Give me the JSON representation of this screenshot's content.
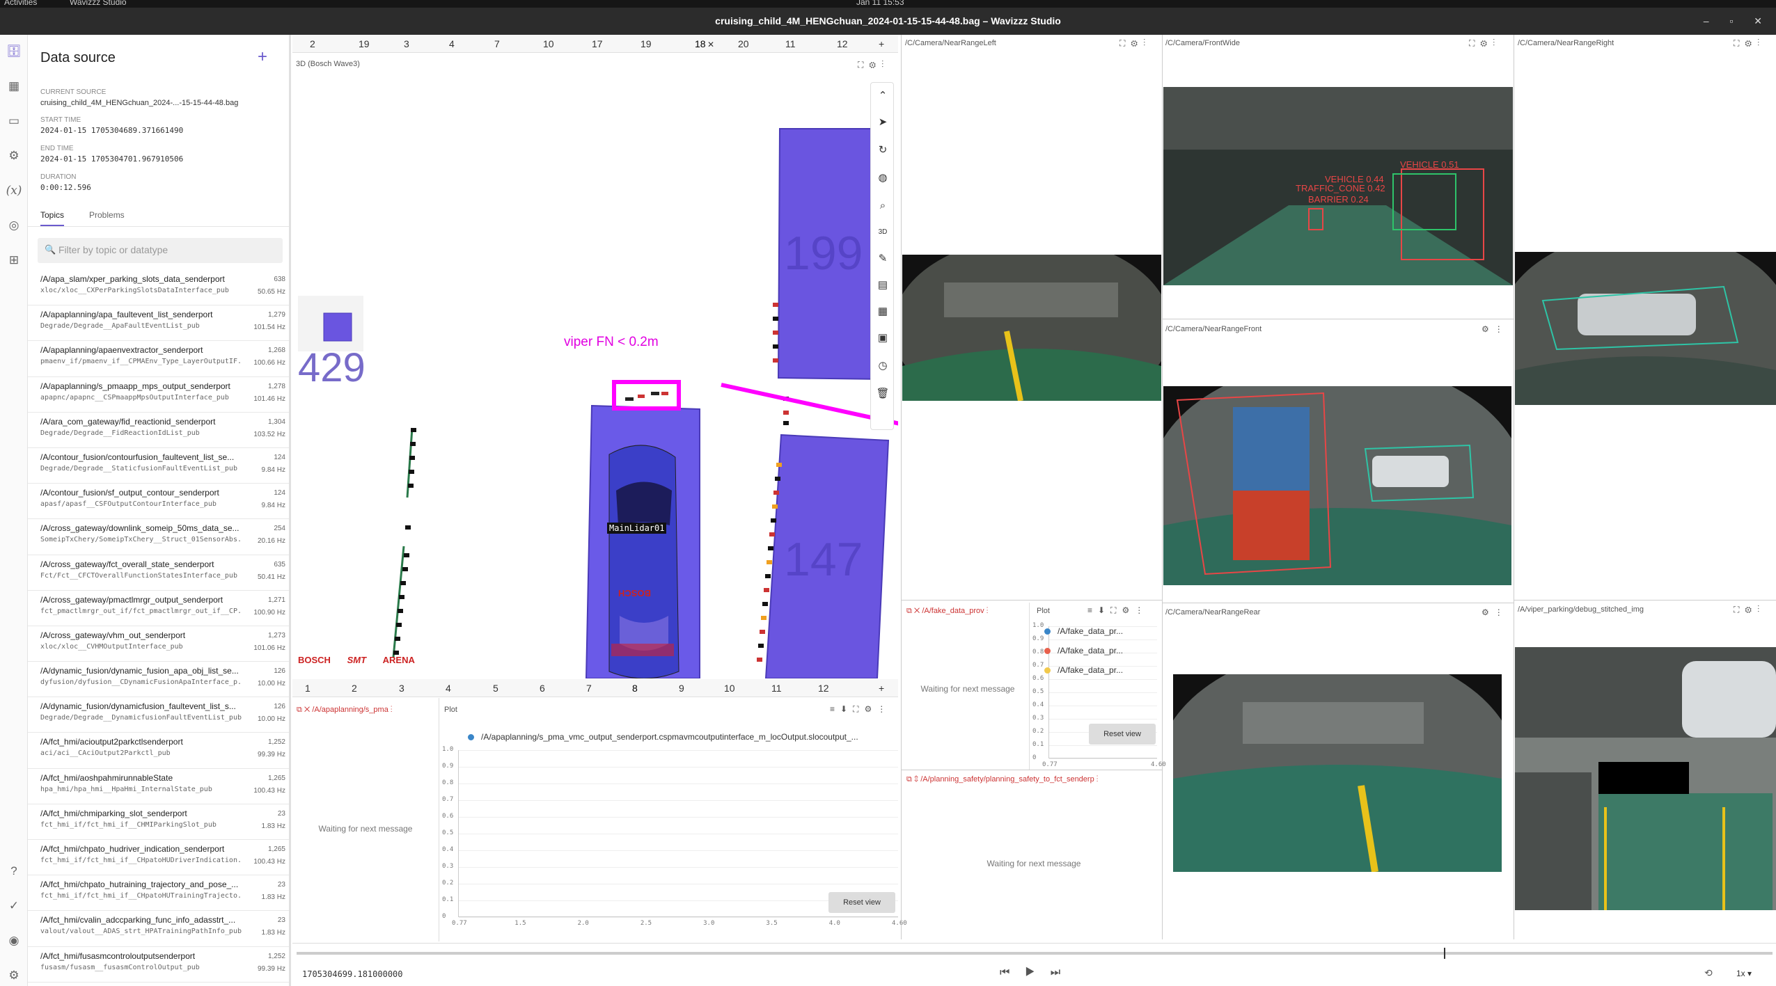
{
  "system": {
    "activities": "Activities",
    "app_name": "Wavizzz Studio",
    "clock": "Jan 11 15:53"
  },
  "window": {
    "title": "cruising_child_4M_HENGchuan_2024-01-15-15-44-48.bag – Wavizzz Studio"
  },
  "datasource": {
    "title": "Data source",
    "current_source_label": "CURRENT SOURCE",
    "current_source": "cruising_child_4M_HENGchuan_2024-...-15-15-44-48.bag",
    "start_label": "START TIME",
    "start": "2024-01-15 1705304689.371661490",
    "end_label": "END TIME",
    "end": "2024-01-15 1705304701.967910506",
    "duration_label": "DURATION",
    "duration": "0:00:12.596",
    "tab_topics": "Topics",
    "tab_problems": "Problems",
    "filter_placeholder": "Filter by topic or datatype",
    "topics": [
      {
        "name": "/A/apa_slam/xper_parking_slots_data_senderport",
        "type": "xloc/xloc__CXPerParkingSlotsDataInterface_pub",
        "count": "638",
        "hz": "50.65 Hz"
      },
      {
        "name": "/A/apaplanning/apa_faultevent_list_senderport",
        "type": "Degrade/Degrade__ApaFaultEventList_pub",
        "count": "1,279",
        "hz": "101.54 Hz"
      },
      {
        "name": "/A/apaplanning/apaenvextractor_senderport",
        "type": "pmaenv_if/pmaenv_if__CPMAEnv_Type_LayerOutputIF...",
        "count": "1,268",
        "hz": "100.66 Hz"
      },
      {
        "name": "/A/apaplanning/s_pmaapp_mps_output_senderport",
        "type": "apapnc/apapnc__CSPmaappMpsOutputInterface_pub",
        "count": "1,278",
        "hz": "101.46 Hz"
      },
      {
        "name": "/A/ara_com_gateway/fid_reactionid_senderport",
        "type": "Degrade/Degrade__FidReactionIdList_pub",
        "count": "1,304",
        "hz": "103.52 Hz"
      },
      {
        "name": "/A/contour_fusion/contourfusion_faultevent_list_se...",
        "type": "Degrade/Degrade__StaticfusionFaultEventList_pub",
        "count": "124",
        "hz": "9.84 Hz"
      },
      {
        "name": "/A/contour_fusion/sf_output_contour_senderport",
        "type": "apasf/apasf__CSFOutputContourInterface_pub",
        "count": "124",
        "hz": "9.84 Hz"
      },
      {
        "name": "/A/cross_gateway/downlink_someip_50ms_data_se...",
        "type": "SomeipTxChery/SomeipTxChery__Struct_01SensorAbs...",
        "count": "254",
        "hz": "20.16 Hz"
      },
      {
        "name": "/A/cross_gateway/fct_overall_state_senderport",
        "type": "Fct/Fct__CFCTOverallFunctionStatesInterface_pub",
        "count": "635",
        "hz": "50.41 Hz"
      },
      {
        "name": "/A/cross_gateway/pmactlmrgr_output_senderport",
        "type": "fct_pmactlmrgr_out_if/fct_pmactlmrgr_out_if__CP...",
        "count": "1,271",
        "hz": "100.90 Hz"
      },
      {
        "name": "/A/cross_gateway/vhm_out_senderport",
        "type": "xloc/xloc__CVHMOutputInterface_pub",
        "count": "1,273",
        "hz": "101.06 Hz"
      },
      {
        "name": "/A/dynamic_fusion/dynamic_fusion_apa_obj_list_se...",
        "type": "dyfusion/dyfusion__CDynamicFusionApaInterface_p...",
        "count": "126",
        "hz": "10.00 Hz"
      },
      {
        "name": "/A/dynamic_fusion/dynamicfusion_faultevent_list_s...",
        "type": "Degrade/Degrade__DynamicfusionFaultEventList_pub",
        "count": "126",
        "hz": "10.00 Hz"
      },
      {
        "name": "/A/fct_hmi/acioutput2parkctlsenderport",
        "type": "aci/aci__CAciOutput2Parkctl_pub",
        "count": "1,252",
        "hz": "99.39 Hz"
      },
      {
        "name": "/A/fct_hmi/aoshpahmirunnableState",
        "type": "hpa_hmi/hpa_hmi__HpaHmi_InternalState_pub",
        "count": "1,265",
        "hz": "100.43 Hz"
      },
      {
        "name": "/A/fct_hmi/chmiparking_slot_senderport",
        "type": "fct_hmi_if/fct_hmi_if__CHMIParkingSlot_pub",
        "count": "23",
        "hz": "1.83 Hz"
      },
      {
        "name": "/A/fct_hmi/chpato_hudriver_indication_senderport",
        "type": "fct_hmi_if/fct_hmi_if__CHpatoHUDriverIndication...",
        "count": "1,265",
        "hz": "100.43 Hz"
      },
      {
        "name": "/A/fct_hmi/chpato_hutraining_trajectory_and_pose_...",
        "type": "fct_hmi_if/fct_hmi_if__CHpatoHUTrainingTrajecto...",
        "count": "23",
        "hz": "1.83 Hz"
      },
      {
        "name": "/A/fct_hmi/cvalin_adccparking_func_info_adasstrt_...",
        "type": "valout/valout__ADAS_strt_HPATrainingPathInfo_pub",
        "count": "23",
        "hz": "1.83 Hz"
      },
      {
        "name": "/A/fct_hmi/fusasmcontroloutputsenderport",
        "type": "fusasm/fusasm__fusasmControlOutput_pub",
        "count": "1,252",
        "hz": "99.39 Hz"
      }
    ]
  },
  "top_tabs": [
    "2",
    "19",
    "3",
    "4",
    "7",
    "10",
    "17",
    "19",
    "18",
    "20",
    "11",
    "12"
  ],
  "top_tabs_add": "+",
  "bottom_tabs": [
    "1",
    "2",
    "3",
    "4",
    "5",
    "6",
    "7",
    "8",
    "9",
    "10",
    "11",
    "12"
  ],
  "view3d": {
    "title": "3D (Bosch Wave3)",
    "annotation": "viper FN < 0.2m",
    "num_429": "429",
    "num_199": "199",
    "num_147": "147",
    "lidar": "MainLidar01",
    "car_brand": "BOSCH",
    "logos": [
      "BOSCH",
      "SMT",
      "ARENA"
    ],
    "colors": {
      "accent": "#ff00ff",
      "vehicle_box": "#5a4fcf",
      "car": "#4a4ad8"
    }
  },
  "cameras": {
    "near_left": "/C/Camera/NearRangeLeft",
    "front_wide": "/C/Camera/FrontWide",
    "near_right": "/C/Camera/NearRangeRight",
    "near_front": "/C/Camera/NearRangeFront",
    "near_rear": "/C/Camera/NearRangeRear",
    "stitched": "/A/viper_parking/debug_stitched_img",
    "frontwide_labels": [
      "VEHICLE 0.44",
      "TRAFFIC_CONE 0.42",
      "BARRIER 0.24",
      "VEHICLE 0.51"
    ]
  },
  "panels": {
    "spma_topic": "/A/apaplanning/s_pma",
    "fake_topic": "/A/fake_data_prov",
    "safety_topic": "/A/planning_safety/planning_safety_to_fct_senderp",
    "waiting": "Waiting for next message",
    "plot_label": "Plot",
    "reset": "Reset view"
  },
  "plot_main": {
    "legend": "/A/apaplanning/s_pma_vmc_output_senderport.cspmavmcoutputinterface_m_locOutput.slocoutput_...",
    "yticks": [
      "1.0",
      "0.9",
      "0.8",
      "0.7",
      "0.6",
      "0.5",
      "0.4",
      "0.3",
      "0.2",
      "0.1",
      "0"
    ],
    "xticks": [
      "0.77",
      "1.5",
      "2.0",
      "2.5",
      "3.0",
      "3.5",
      "4.0",
      "4.60"
    ]
  },
  "plot_small": {
    "legend": [
      {
        "name": "/A/fake_data_pr...",
        "color": "#3a86c8"
      },
      {
        "name": "/A/fake_data_pr...",
        "color": "#e8604c"
      },
      {
        "name": "/A/fake_data_pr...",
        "color": "#f2c94c"
      }
    ],
    "yticks": [
      "1.0",
      "0.9",
      "0.8",
      "0.7",
      "0.6",
      "0.5",
      "0.4",
      "0.3",
      "0.2",
      "0.1",
      "0"
    ],
    "xticks": [
      "0.77",
      "4.60"
    ]
  },
  "playback": {
    "timestamp": "1705304699.181000000",
    "speed": "1x"
  }
}
